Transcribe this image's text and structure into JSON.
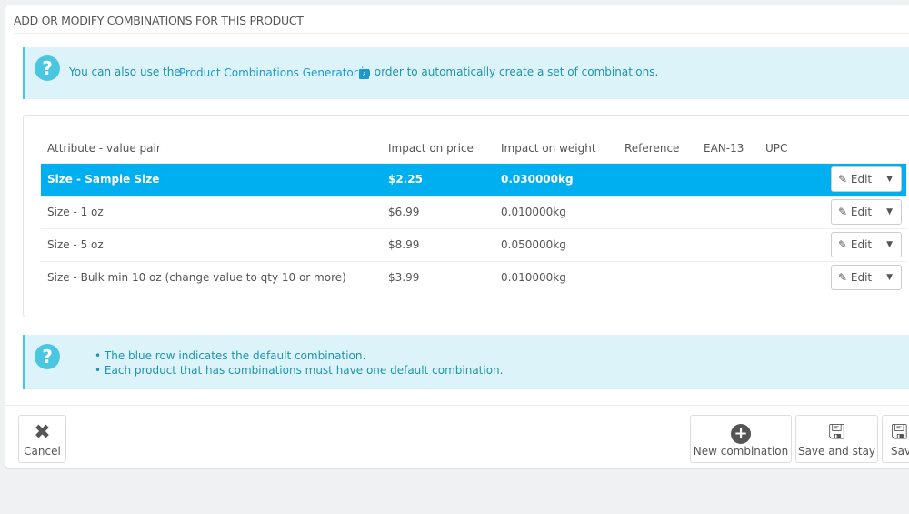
{
  "panel_title": "ADD OR MODIFY COMBINATIONS FOR THIS PRODUCT",
  "info": {
    "prefix": "You can also use the",
    "link": "Product Combinations Generator",
    "suffix": "in order to automatically create a set of combinations."
  },
  "table": {
    "headers": [
      "Attribute - value pair",
      "Impact on price",
      "Impact on weight",
      "Reference",
      "EAN-13",
      "UPC"
    ],
    "rows": [
      {
        "attr": "Size - Sample Size",
        "price": "$2.25",
        "weight": "0.030000kg",
        "default": true
      },
      {
        "attr": "Size - 1 oz",
        "price": "$6.99",
        "weight": "0.010000kg"
      },
      {
        "attr": "Size - 5 oz",
        "price": "$8.99",
        "weight": "0.050000kg"
      },
      {
        "attr": "Size - Bulk min 10 oz (change value to qty 10 or more)",
        "price": "$3.99",
        "weight": "0.010000kg"
      }
    ],
    "edit_label": "Edit"
  },
  "help": [
    "The blue row indicates the default combination.",
    "Each product that has combinations must have one default combination."
  ],
  "footer": {
    "cancel": "Cancel",
    "new": "New combination",
    "save_stay": "Save and stay",
    "save": "Save"
  },
  "colors": {
    "default_row": "#00aff0",
    "alert_bg": "#dcf4f9",
    "alert_text": "#1e94ab"
  }
}
